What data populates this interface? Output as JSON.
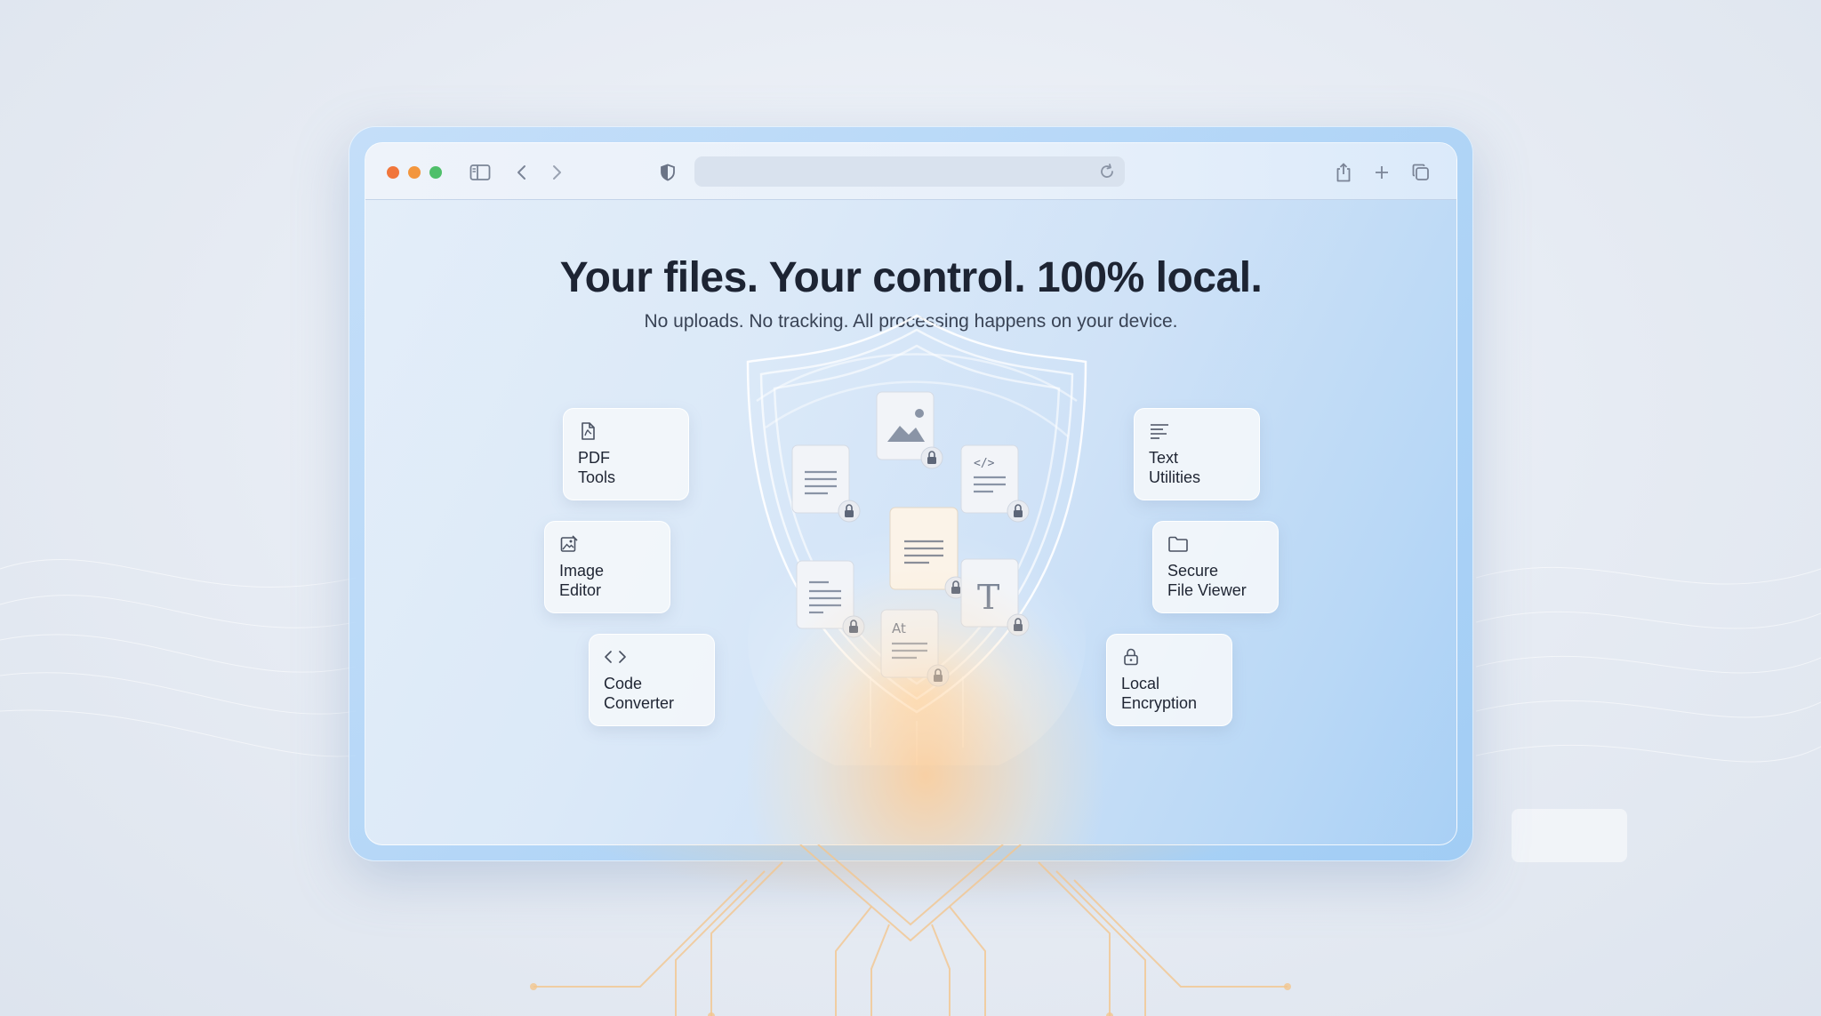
{
  "browser": {
    "url": ""
  },
  "hero": {
    "title": "Your files. Your control. 100% local.",
    "subtitle": "No uploads. No tracking. All processing happens on your device."
  },
  "tools": {
    "pdf": {
      "label": "PDF\nTools",
      "icon": "pdf-file-icon"
    },
    "image": {
      "label": "Image\nEditor",
      "icon": "image-edit-icon"
    },
    "code": {
      "label": "Code\nConverter",
      "icon": "code-brackets-icon"
    },
    "text": {
      "label": "Text\nUtilities",
      "icon": "text-lines-icon"
    },
    "viewer": {
      "label": "Secure\nFile Viewer",
      "icon": "folder-icon"
    },
    "encryption": {
      "label": "Local\nEncryption",
      "icon": "lock-icon"
    }
  },
  "colors": {
    "accent": "#1d2433",
    "glow": "#ffcd96",
    "window_frame": "#a9d0f5"
  }
}
